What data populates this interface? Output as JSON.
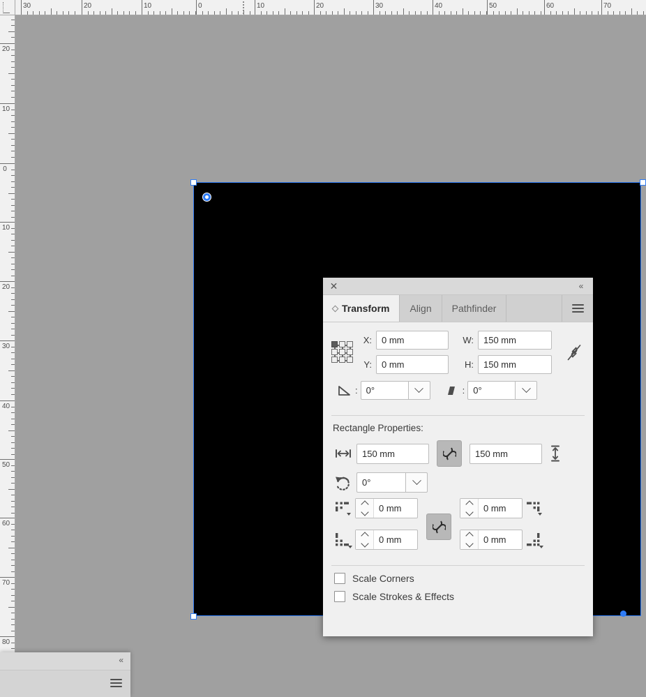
{
  "app": {
    "canvas_bg_color": "#a0a0a0",
    "artboard_fill_color": "#000000",
    "selection_color": "#2f7cf6"
  },
  "rulers": {
    "unit": "mm",
    "horizontal_labels": [
      "30",
      "20",
      "10",
      "0",
      "10",
      "20",
      "30",
      "40",
      "50",
      "60",
      "70"
    ],
    "vertical_labels": [
      "20",
      "10",
      "0",
      "10",
      "20",
      "30",
      "40",
      "50",
      "60",
      "70",
      "80"
    ]
  },
  "panel": {
    "close_icon": "✕",
    "collapse_icon": "«",
    "menu_icon": "hamburger-icon",
    "tabs": [
      {
        "label": "Transform",
        "active": true
      },
      {
        "label": "Align",
        "active": false
      },
      {
        "label": "Pathfinder",
        "active": false
      }
    ],
    "transform": {
      "reference_point": "top-left",
      "x_label": "X:",
      "x_value": "0 mm",
      "y_label": "Y:",
      "y_value": "0 mm",
      "w_label": "W:",
      "w_value": "150 mm",
      "h_label": "H:",
      "h_value": "150 mm",
      "link_wh_icon": "broken-link-icon",
      "angle_label": ":",
      "angle_value": "0°",
      "shear_label": ":",
      "shear_value": "0°"
    },
    "rectangle": {
      "section_title": "Rectangle Properties:",
      "width_icon": "width-arrows-icon",
      "width_value": "150 mm",
      "link_icon": "link-icon",
      "height_value": "150 mm",
      "height_icon": "height-arrows-icon",
      "rotate_icon": "rotate-icon",
      "rotation_value": "0°",
      "corners": [
        {
          "name": "top-left",
          "icon": "corner-top-left-icon",
          "value": "0 mm"
        },
        {
          "name": "top-right",
          "icon": "corner-top-right-icon",
          "value": "0 mm"
        },
        {
          "name": "bottom-left",
          "icon": "corner-bottom-left-icon",
          "value": "0 mm"
        },
        {
          "name": "bottom-right",
          "icon": "corner-bottom-right-icon",
          "value": "0 mm"
        }
      ],
      "corner_link_icon": "link-icon"
    },
    "options": [
      {
        "label": "Scale Corners",
        "checked": false
      },
      {
        "label": "Scale Strokes & Effects",
        "checked": false
      }
    ]
  },
  "bottom_panel": {
    "collapse_icon": "«",
    "menu_icon": "hamburger-icon"
  }
}
